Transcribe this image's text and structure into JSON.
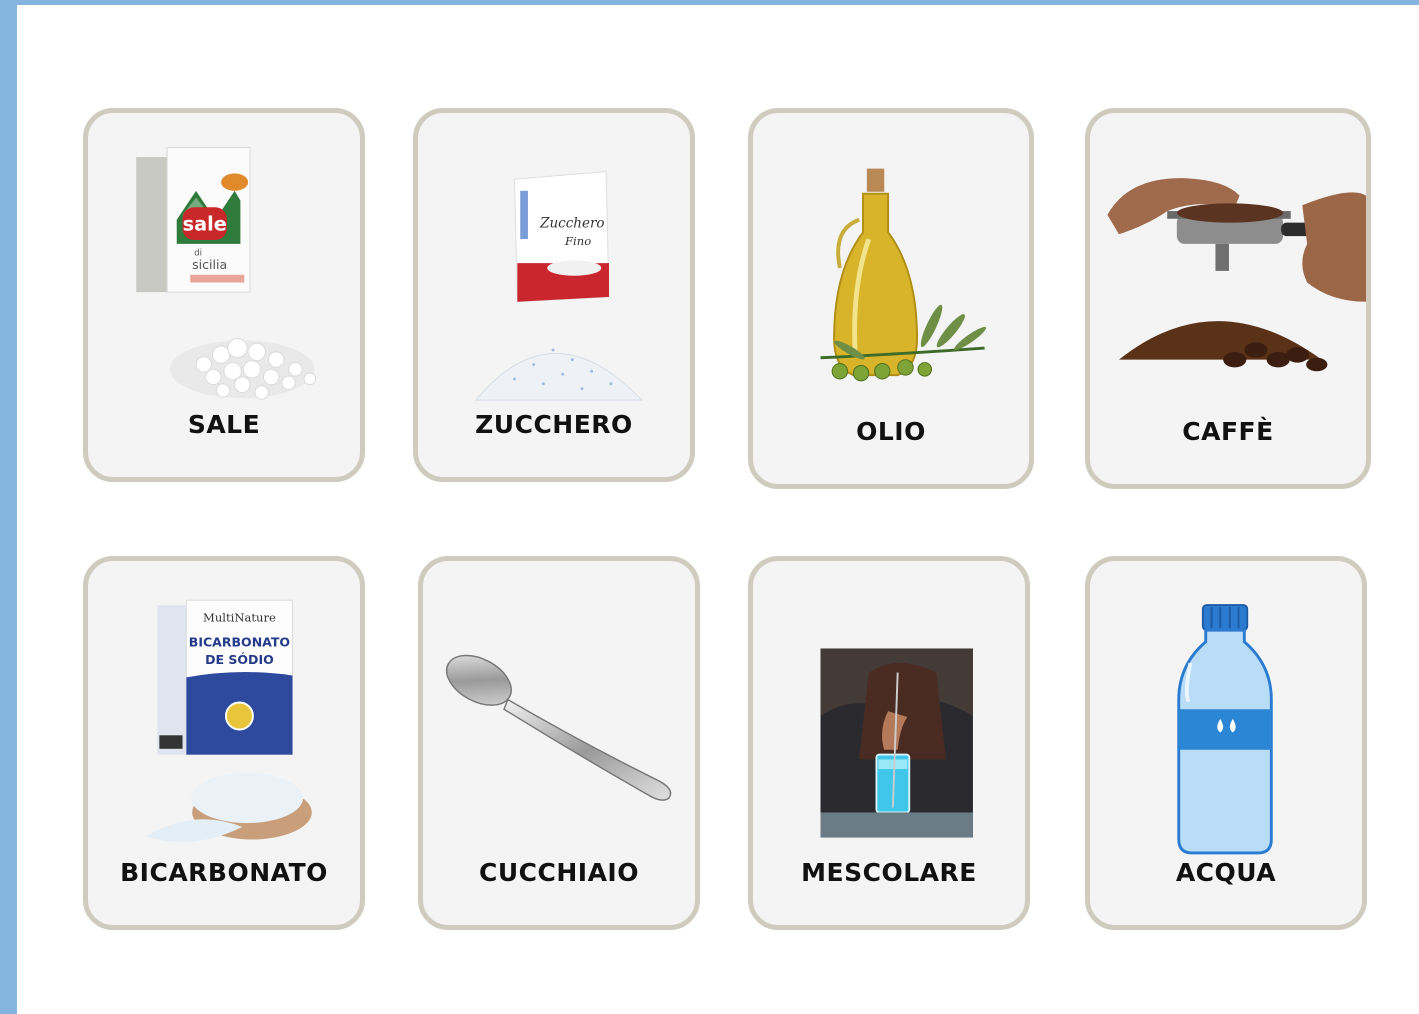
{
  "cards": [
    {
      "label": "SALE",
      "icon": "salt-icon"
    },
    {
      "label": "ZUCCHERO",
      "icon": "sugar-icon"
    },
    {
      "label": "OLIO",
      "icon": "olive-oil-icon"
    },
    {
      "label": "CAFFÈ",
      "icon": "coffee-icon"
    },
    {
      "label": "BICARBONATO",
      "icon": "baking-soda-icon"
    },
    {
      "label": "CUCCHIAIO",
      "icon": "spoon-icon"
    },
    {
      "label": "MESCOLARE",
      "icon": "stirring-icon"
    },
    {
      "label": "ACQUA",
      "icon": "water-bottle-icon"
    }
  ],
  "pictures": {
    "salt_box": {
      "brand": "sale",
      "line2": "di",
      "line3": "sicilia"
    },
    "sugar_bag": {
      "line1": "Zucchero",
      "line2": "Fino"
    },
    "soda_box": {
      "brand": "MultiNature",
      "line1": "BICARBONATO",
      "line2": "DE SÓDIO"
    }
  },
  "colors": {
    "frame": "#85b4e1",
    "card_border": "#cfcbbe",
    "card_fill": "#f4f4f4",
    "label": "#111111"
  }
}
